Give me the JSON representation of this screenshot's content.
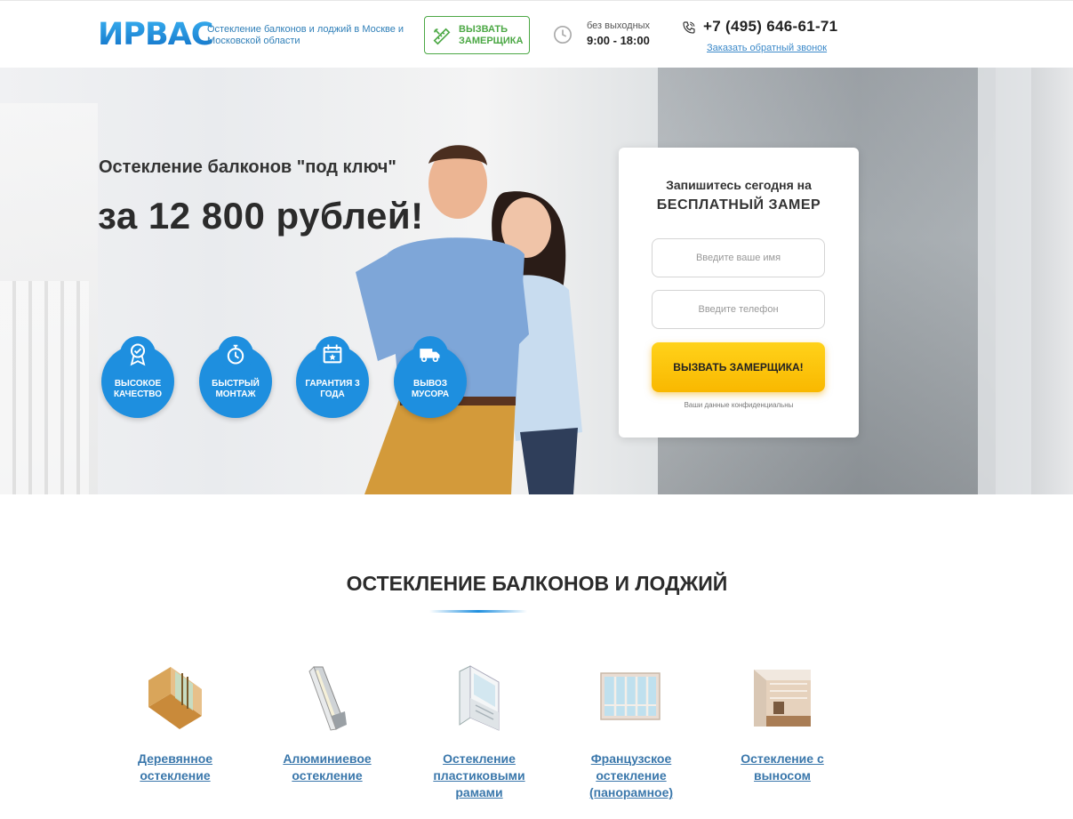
{
  "header": {
    "logo": "ИРВАС",
    "tagline": "Остекление балконов и лоджий в Москве и Московской области",
    "cta_button": "ВЫЗВАТЬ ЗАМЕРЩИКА",
    "hours_caption": "без выходных",
    "hours_value": "9:00 - 18:00",
    "phone": "+7 (495) 646-61-71",
    "callback_link": "Заказать обратный звонок"
  },
  "hero": {
    "title": "Остекление балконов \"под ключ\"",
    "price": "за 12 800 рублей!",
    "features": [
      {
        "label": "ВЫСОКОЕ КАЧЕСТВО",
        "icon": "award-medal-icon"
      },
      {
        "label": "БЫСТРЫЙ МОНТАЖ",
        "icon": "stopwatch-icon"
      },
      {
        "label": "ГАРАНТИЯ 3 ГОДА",
        "icon": "calendar-icon"
      },
      {
        "label": "ВЫВОЗ МУСОРА",
        "icon": "truck-icon"
      }
    ]
  },
  "form": {
    "title_line1": "Запишитесь сегодня на",
    "title_line2": "БЕСПЛАТНЫЙ ЗАМЕР",
    "name_placeholder": "Введите ваше имя",
    "phone_placeholder": "Введите телефон",
    "submit": "ВЫЗВАТЬ ЗАМЕРЩИКА!",
    "privacy_note": "Ваши данные конфиденциальны"
  },
  "section": {
    "title": "ОСТЕКЛЕНИЕ БАЛКОНОВ И ЛОДЖИЙ",
    "types": [
      {
        "label": "Деревянное остекление",
        "icon": "wooden-frame-icon"
      },
      {
        "label": "Алюминиевое остекление",
        "icon": "aluminium-profile-icon"
      },
      {
        "label": "Остекление пластиковыми рамами",
        "icon": "plastic-profile-icon"
      },
      {
        "label": "Французское остекление (панорамное)",
        "icon": "panoramic-balcony-icon"
      },
      {
        "label": "Остекление с выносом",
        "icon": "extended-balcony-icon"
      }
    ]
  },
  "colors": {
    "brand_blue": "#1e8fdf",
    "cta_green": "#4ca845",
    "button_yellow": "#ffd21a",
    "link_blue": "#3a77ab"
  }
}
